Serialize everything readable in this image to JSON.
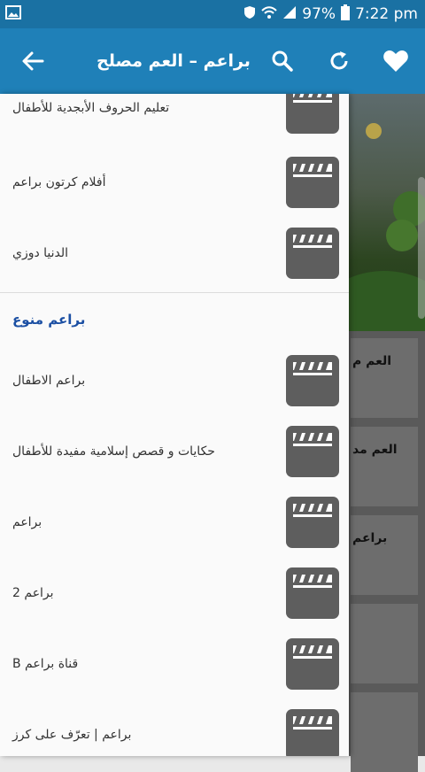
{
  "status_bar": {
    "battery": "97%",
    "time": "7:22 pm",
    "icons": [
      "image-icon",
      "shield-icon",
      "wifi-icon",
      "signal-icon",
      "battery-icon"
    ]
  },
  "app_bar": {
    "title": "براعم – العم مصلح",
    "icons": [
      "back-arrow-icon",
      "search-icon",
      "refresh-icon",
      "heart-icon"
    ],
    "color": "#1f80b8"
  },
  "drawer": {
    "items_top": [
      {
        "label": "تعليم الحروف الأبجدية للأطفال"
      },
      {
        "label": "أفلام كرتون براعم"
      },
      {
        "label": "الدنيا دوزي"
      }
    ],
    "section_title": "براعم منوع",
    "items_bottom": [
      {
        "label": "براعم الاطفال"
      },
      {
        "label": "حكايات و قصص إسلامية مفيدة للأطفال"
      },
      {
        "label": "براعم"
      },
      {
        "label": "براعم 2"
      },
      {
        "label": "قناة براعم B"
      },
      {
        "label": "براعم | تعرّف على كرز"
      }
    ],
    "item_icon": "clapperboard-icon",
    "section_color": "#1b4fa3"
  },
  "background_cards": [
    {
      "title": "العم م"
    },
    {
      "title": "العم مد"
    },
    {
      "title": "براعم"
    }
  ]
}
